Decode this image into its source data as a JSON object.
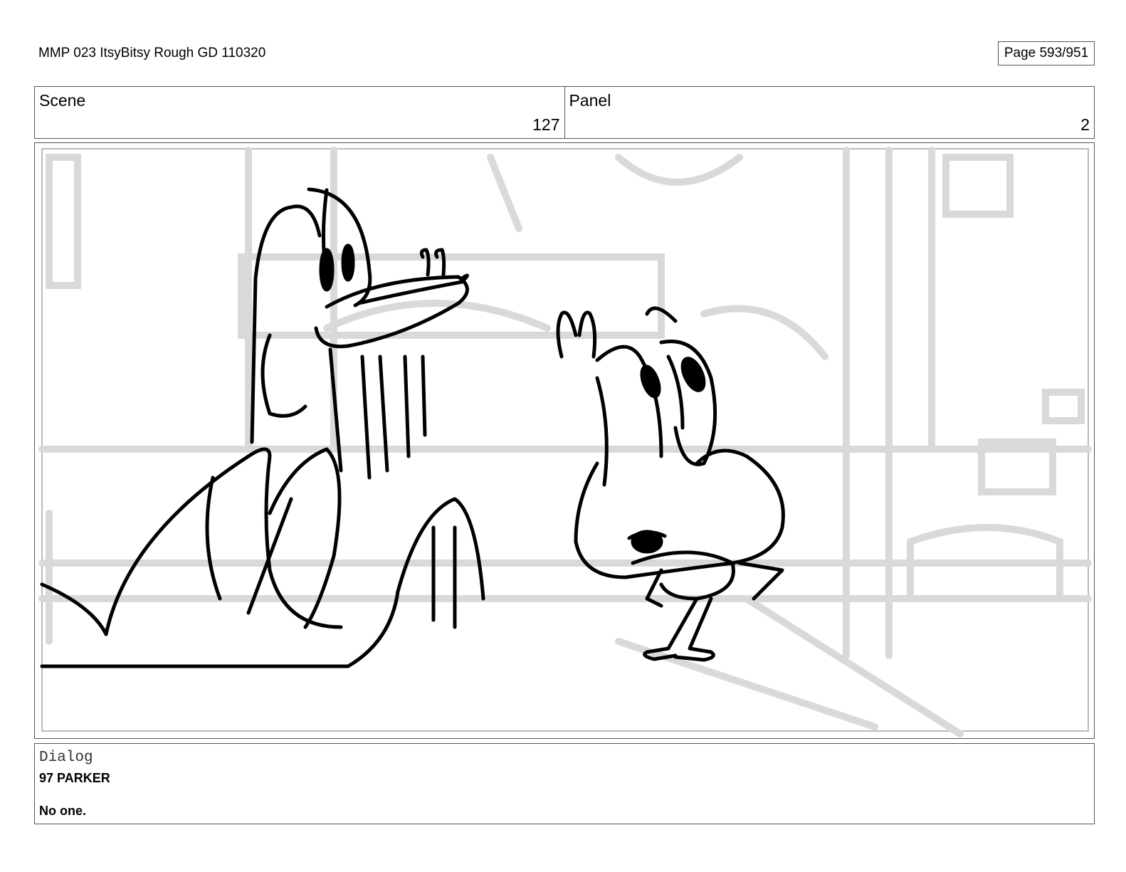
{
  "header": {
    "doc_title": "MMP 023 ItsyBitsy Rough GD 110320",
    "page_label": "Page 593/951"
  },
  "scene": {
    "label": "Scene",
    "value": "127"
  },
  "panel": {
    "label": "Panel",
    "value": "2"
  },
  "dialog": {
    "label": "Dialog",
    "speaker": "97 PARKER",
    "line": "No one."
  }
}
